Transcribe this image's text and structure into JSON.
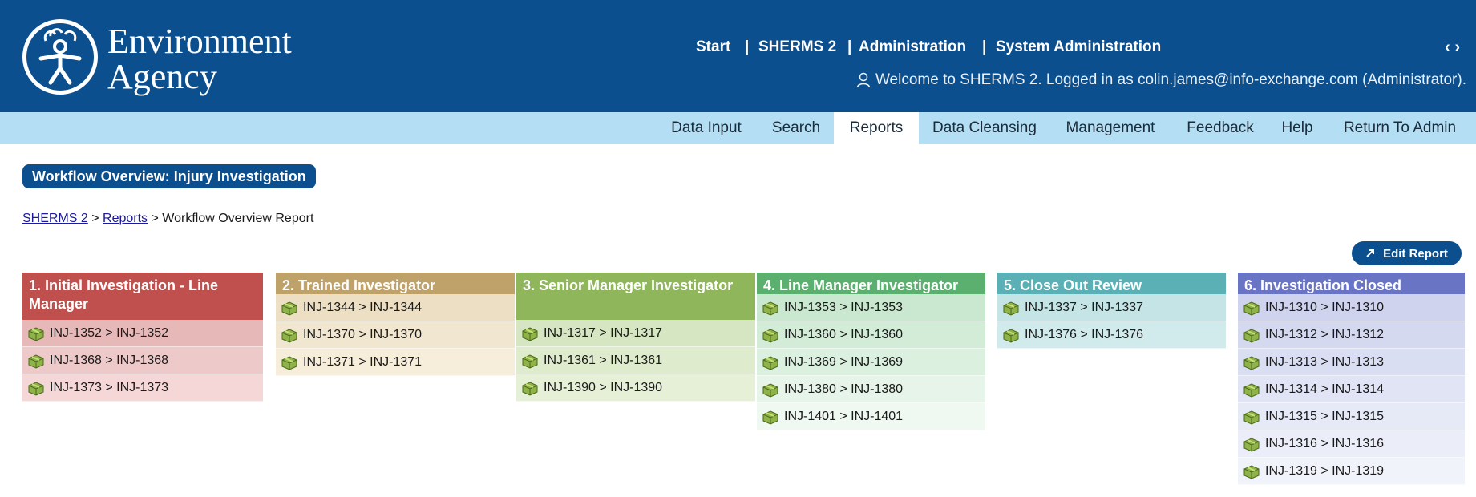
{
  "logo": {
    "line1": "Environment",
    "line2": "Agency"
  },
  "topnav": {
    "start": "Start",
    "sep1": "|",
    "sherms": "SHERMS 2",
    "sep2": "|",
    "admin": "Administration",
    "sep3": "|",
    "sysadmin": "System Administration",
    "arrows": "‹ ›"
  },
  "welcome": "Welcome to SHERMS 2. Logged in as colin.james@info-exchange.com (Administrator).",
  "menu": [
    "Data Input",
    "Search",
    "Reports",
    "Data Cleansing",
    "Management",
    "Feedback",
    "Help",
    "Return To Admin"
  ],
  "active_menu": "Reports",
  "page_title": "Workflow Overview: Injury Investigation",
  "breadcrumb": {
    "home": "SHERMS 2",
    "sep1": " > ",
    "reports": "Reports",
    "sep2": " > ",
    "current": "Workflow Overview Report"
  },
  "edit_button": "Edit Report",
  "columns": [
    {
      "title": "1. Initial Investigation - Line Manager",
      "header_color": "#c0504d",
      "row_colors": [
        "#e6b8b7",
        "#eec9c9",
        "#f5d7d7"
      ],
      "items": [
        "INJ-1352 > INJ-1352",
        "INJ-1368 > INJ-1368",
        "INJ-1373 > INJ-1373"
      ]
    },
    {
      "title": "2. Trained Investigator",
      "header_color": "#bfa26a",
      "row_colors": [
        "#ecdfc3",
        "#f1e6cf",
        "#f6eedb"
      ],
      "items": [
        "INJ-1344 > INJ-1344",
        "INJ-1370 > INJ-1370",
        "INJ-1371 > INJ-1371"
      ]
    },
    {
      "title": "3. Senior Manager Investigator",
      "header_color": "#8fb65a",
      "row_colors": [
        "#d6e6c2",
        "#deebcc",
        "#e6f0d7"
      ],
      "items": [
        "INJ-1317 > INJ-1317",
        "INJ-1361 > INJ-1361",
        "INJ-1390 > INJ-1390"
      ]
    },
    {
      "title": "4. Line Manager Investigator",
      "header_color": "#5cb06f",
      "row_colors": [
        "#c9e8cf",
        "#d3ecd8",
        "#dcf0e0",
        "#e6f4e9",
        "#eff8f1"
      ],
      "items": [
        "INJ-1353 > INJ-1353",
        "INJ-1360 > INJ-1360",
        "INJ-1369 > INJ-1369",
        "INJ-1380 > INJ-1380",
        "INJ-1401 > INJ-1401"
      ]
    },
    {
      "title": "5. Close Out Review",
      "header_color": "#5bb0b5",
      "row_colors": [
        "#c4e4e6",
        "#d1eaec"
      ],
      "items": [
        "INJ-1337 > INJ-1337",
        "INJ-1376 > INJ-1376"
      ]
    },
    {
      "title": "6. Investigation Closed",
      "header_color": "#6a74c4",
      "row_colors": [
        "#cfd3ee",
        "#d5d9f0",
        "#dadef2",
        "#e0e4f4",
        "#e6e9f6",
        "#ebeef8",
        "#f1f3fa"
      ],
      "items": [
        "INJ-1310 > INJ-1310",
        "INJ-1312 > INJ-1312",
        "INJ-1313 > INJ-1313",
        "INJ-1314 > INJ-1314",
        "INJ-1315 > INJ-1315",
        "INJ-1316 > INJ-1316",
        "INJ-1319 > INJ-1319"
      ]
    }
  ],
  "row_icon": "package-box-icon",
  "colors": {
    "header_blue": "#0b4f8f",
    "menu_bar": "#b3def3"
  }
}
